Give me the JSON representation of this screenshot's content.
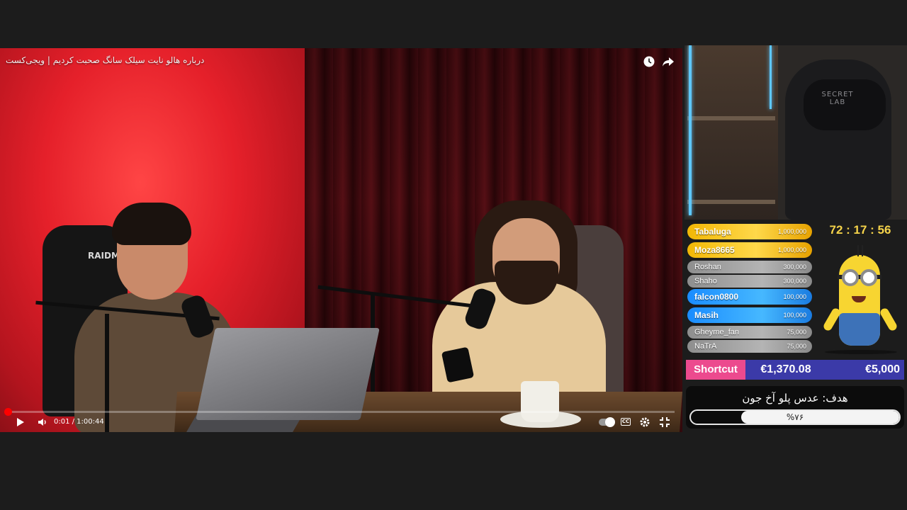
{
  "video": {
    "title": "درباره هالو نایت سیلک سانگ صحبت کردیم | ویجی‌کست",
    "chair_brand": "RAIDMA",
    "time_display": "0:01 / 1:00:44",
    "progress": 0.0003,
    "icons": {
      "clock": "clock-icon",
      "share": "share-icon",
      "play": "play-icon",
      "volume": "volume-icon",
      "autoplay": "autoplay-toggle-icon",
      "captions": "cc-icon",
      "settings": "gear-icon",
      "fullscreen": "exit-fullscreen-icon"
    }
  },
  "webcam": {
    "chair_brand": "SECRET LAB"
  },
  "timer": "72 : 17 : 56",
  "donors": [
    {
      "name": "Tabaluga",
      "amount": "1,000,000",
      "tier": "gold"
    },
    {
      "name": "Moza8665",
      "amount": "1,000,000",
      "tier": "gold"
    },
    {
      "name": "Roshan",
      "amount": "300,000",
      "tier": "grey"
    },
    {
      "name": "Shaho",
      "amount": "300,000",
      "tier": "grey"
    },
    {
      "name": "falcon0800",
      "amount": "100,000",
      "tier": "blue"
    },
    {
      "name": "Masih",
      "amount": "100,000",
      "tier": "blue"
    },
    {
      "name": "Gheyme_fan",
      "amount": "75,000",
      "tier": "grey"
    },
    {
      "name": "NaTrA",
      "amount": "75,000",
      "tier": "grey"
    }
  ],
  "shortcut": {
    "label": "Shortcut",
    "current": "€1,370.08",
    "target": "€5,000"
  },
  "goal": {
    "title": "هدف: عدس پلو آخ جون",
    "percent_label": "%۷۶",
    "fraction": 0.76
  },
  "colors": {
    "youtube_red": "#ff0000",
    "shortcut_pink": "#ec4a8e",
    "shortcut_blue": "#3b3aa8",
    "timer_yellow": "#f5d34a"
  }
}
